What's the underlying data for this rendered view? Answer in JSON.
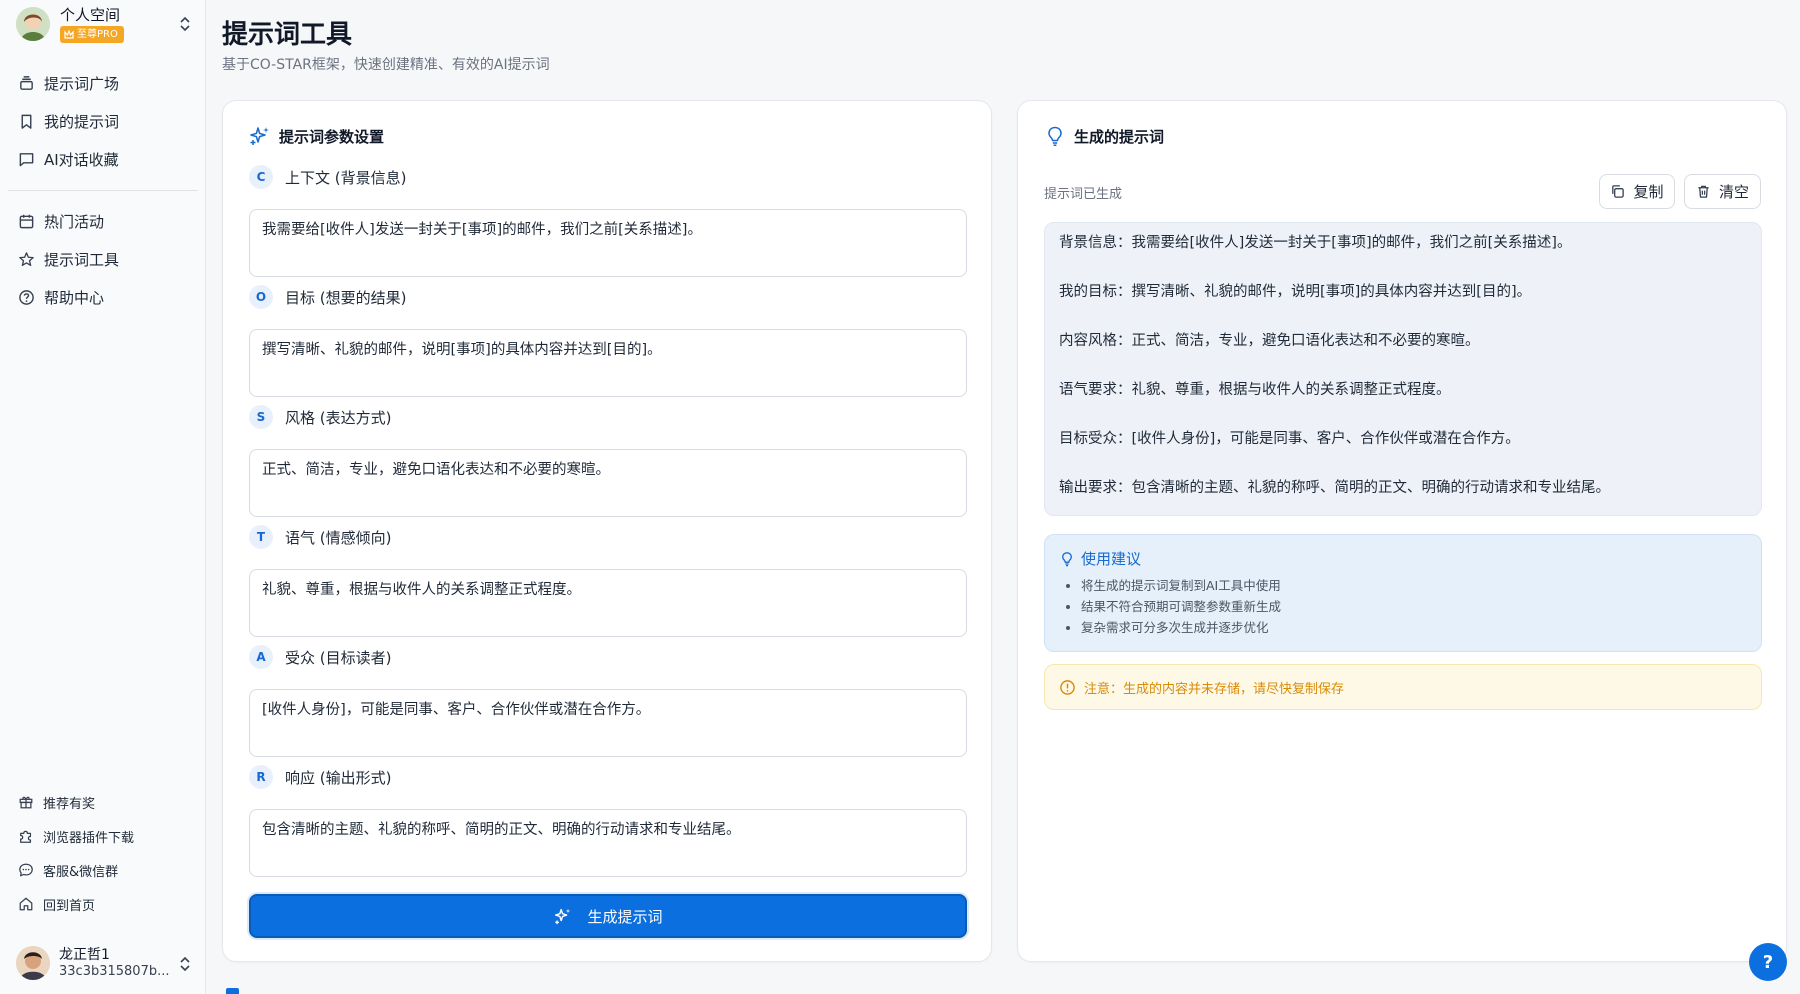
{
  "workspace": {
    "name": "个人空间",
    "badge": "至尊PRO"
  },
  "nav": {
    "top": [
      {
        "label": "提示词广场",
        "icon": "layers-icon"
      },
      {
        "label": "我的提示词",
        "icon": "bookmark-icon"
      },
      {
        "label": "AI对话收藏",
        "icon": "chat-icon"
      }
    ],
    "mid": [
      {
        "label": "热门活动",
        "icon": "calendar-icon"
      },
      {
        "label": "提示词工具",
        "icon": "star-icon"
      },
      {
        "label": "帮助中心",
        "icon": "help-circle-icon"
      }
    ],
    "bottom": [
      {
        "label": "推荐有奖",
        "icon": "gift-icon"
      },
      {
        "label": "浏览器插件下载",
        "icon": "puzzle-icon"
      },
      {
        "label": "客服&微信群",
        "icon": "message-icon"
      },
      {
        "label": "回到首页",
        "icon": "home-icon"
      }
    ]
  },
  "user": {
    "name": "龙正哲1",
    "id": "33c3b315807b..."
  },
  "page": {
    "title": "提示词工具",
    "subtitle": "基于CO-STAR框架，快速创建精准、有效的AI提示词"
  },
  "form": {
    "title": "提示词参数设置",
    "fields": [
      {
        "letter": "C",
        "label": "上下文 (背景信息)",
        "value": "我需要给[收件人]发送一封关于[事项]的邮件，我们之前[关系描述]。"
      },
      {
        "letter": "O",
        "label": "目标 (想要的结果)",
        "value": "撰写清晰、礼貌的邮件，说明[事项]的具体内容并达到[目的]。"
      },
      {
        "letter": "S",
        "label": "风格 (表达方式)",
        "value": "正式、简洁，专业，避免口语化表达和不必要的寒暄。"
      },
      {
        "letter": "T",
        "label": "语气 (情感倾向)",
        "value": "礼貌、尊重，根据与收件人的关系调整正式程度。"
      },
      {
        "letter": "A",
        "label": "受众 (目标读者)",
        "value": "[收件人身份]，可能是同事、客户、合作伙伴或潜在合作方。"
      },
      {
        "letter": "R",
        "label": "响应 (输出形式)",
        "value": "包含清晰的主题、礼貌的称呼、简明的正文、明确的行动请求和专业结尾。"
      }
    ],
    "generate_label": "生成提示词"
  },
  "result": {
    "title": "生成的提示词",
    "status": "提示词已生成",
    "copy_label": "复制",
    "clear_label": "清空",
    "lines": [
      "背景信息：我需要给[收件人]发送一封关于[事项]的邮件，我们之前[关系描述]。",
      "我的目标：撰写清晰、礼貌的邮件，说明[事项]的具体内容并达到[目的]。",
      "内容风格：正式、简洁，专业，避免口语化表达和不必要的寒暄。",
      "语气要求：礼貌、尊重，根据与收件人的关系调整正式程度。",
      "目标受众：[收件人身份]，可能是同事、客户、合作伙伴或潜在合作方。",
      "输出要求：包含清晰的主题、礼貌的称呼、简明的正文、明确的行动请求和专业结尾。"
    ],
    "tips_title": "使用建议",
    "tips": [
      "将生成的提示词复制到AI工具中使用",
      "结果不符合预期可调整参数重新生成",
      "复杂需求可分多次生成并逐步优化"
    ],
    "notice": "注意：生成的内容并未存储，请尽快复制保存"
  },
  "help_fab": "?",
  "colors": {
    "primary": "#0b6fe0",
    "pro": "#f5a623",
    "warning": "#d98b06"
  }
}
